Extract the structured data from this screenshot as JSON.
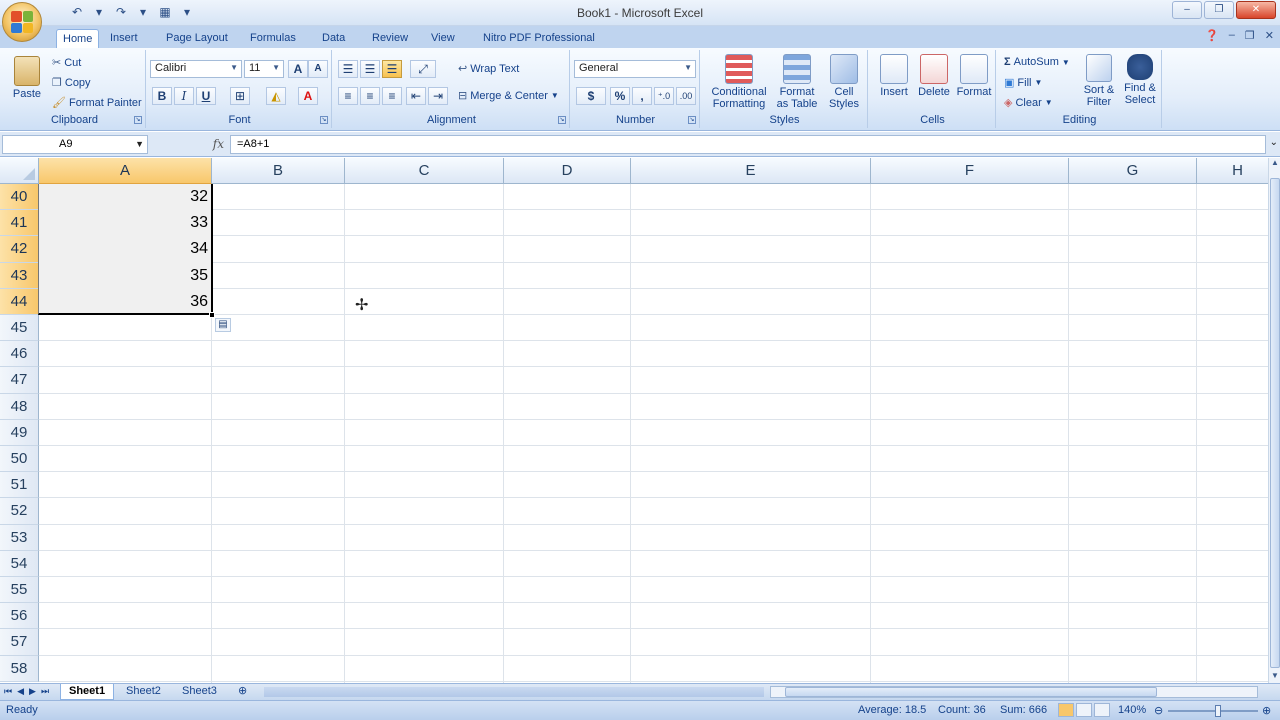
{
  "window": {
    "title": "Book1 - Microsoft Excel",
    "controls": [
      "–",
      "❐",
      "✕"
    ]
  },
  "qat": {
    "save_icon": "💾",
    "undo": "↶",
    "redo": "↷",
    "dropdown": "▾"
  },
  "tabs": [
    {
      "label": "Home",
      "active": true
    },
    {
      "label": "Insert"
    },
    {
      "label": "Page Layout"
    },
    {
      "label": "Formulas"
    },
    {
      "label": "Data"
    },
    {
      "label": "Review"
    },
    {
      "label": "View"
    },
    {
      "label": "Nitro PDF Professional"
    }
  ],
  "ribbon": {
    "clipboard": {
      "label": "Clipboard",
      "paste": "Paste",
      "cut": "Cut",
      "copy": "Copy",
      "format_painter": "Format Painter"
    },
    "font": {
      "label": "Font",
      "font_name": "Calibri",
      "font_size": "11",
      "bold": "B",
      "italic": "I",
      "underline": "U",
      "grow": "A",
      "shrink": "A"
    },
    "alignment": {
      "label": "Alignment",
      "wrap_text": "Wrap Text",
      "merge_center": "Merge & Center"
    },
    "number": {
      "label": "Number",
      "format": "General",
      "currency": "$",
      "percent": "%",
      "comma": ",",
      "inc_decimal": "⁺.0",
      "dec_decimal": ".00"
    },
    "styles": {
      "label": "Styles",
      "conditional": "Conditional",
      "conditional2": "Formatting",
      "format_table": "Format",
      "format_table2": "as Table",
      "cell_styles": "Cell",
      "cell_styles2": "Styles"
    },
    "cells": {
      "label": "Cells",
      "insert": "Insert",
      "delete": "Delete",
      "format": "Format"
    },
    "editing": {
      "label": "Editing",
      "autosum": "AutoSum",
      "fill": "Fill",
      "clear": "Clear",
      "sort": "Sort &",
      "sort2": "Filter",
      "find": "Find &",
      "find2": "Select"
    }
  },
  "formula_bar": {
    "name_box": "A9",
    "fx": "fx",
    "formula": "=A8+1"
  },
  "columns": [
    {
      "label": "A",
      "selected": true
    },
    {
      "label": "B"
    },
    {
      "label": "C"
    },
    {
      "label": "D"
    },
    {
      "label": "E"
    },
    {
      "label": "F"
    },
    {
      "label": "G"
    },
    {
      "label": "H"
    }
  ],
  "rows": [
    {
      "label": "40",
      "value": "32",
      "selected": true
    },
    {
      "label": "41",
      "value": "33",
      "selected": true
    },
    {
      "label": "42",
      "value": "34",
      "selected": true
    },
    {
      "label": "43",
      "value": "35",
      "selected": true
    },
    {
      "label": "44",
      "value": "36",
      "selected": true
    },
    {
      "label": "45"
    },
    {
      "label": "46"
    },
    {
      "label": "47"
    },
    {
      "label": "48"
    },
    {
      "label": "49"
    },
    {
      "label": "50"
    },
    {
      "label": "51"
    },
    {
      "label": "52"
    },
    {
      "label": "53"
    },
    {
      "label": "54"
    },
    {
      "label": "55"
    },
    {
      "label": "56"
    },
    {
      "label": "57"
    },
    {
      "label": "58"
    }
  ],
  "sheets": [
    {
      "label": "Sheet1",
      "active": true
    },
    {
      "label": "Sheet2"
    },
    {
      "label": "Sheet3"
    }
  ],
  "status": {
    "ready": "Ready",
    "average": "Average: 18.5",
    "count": "Count: 36",
    "sum": "Sum: 666",
    "zoom": "140%"
  }
}
